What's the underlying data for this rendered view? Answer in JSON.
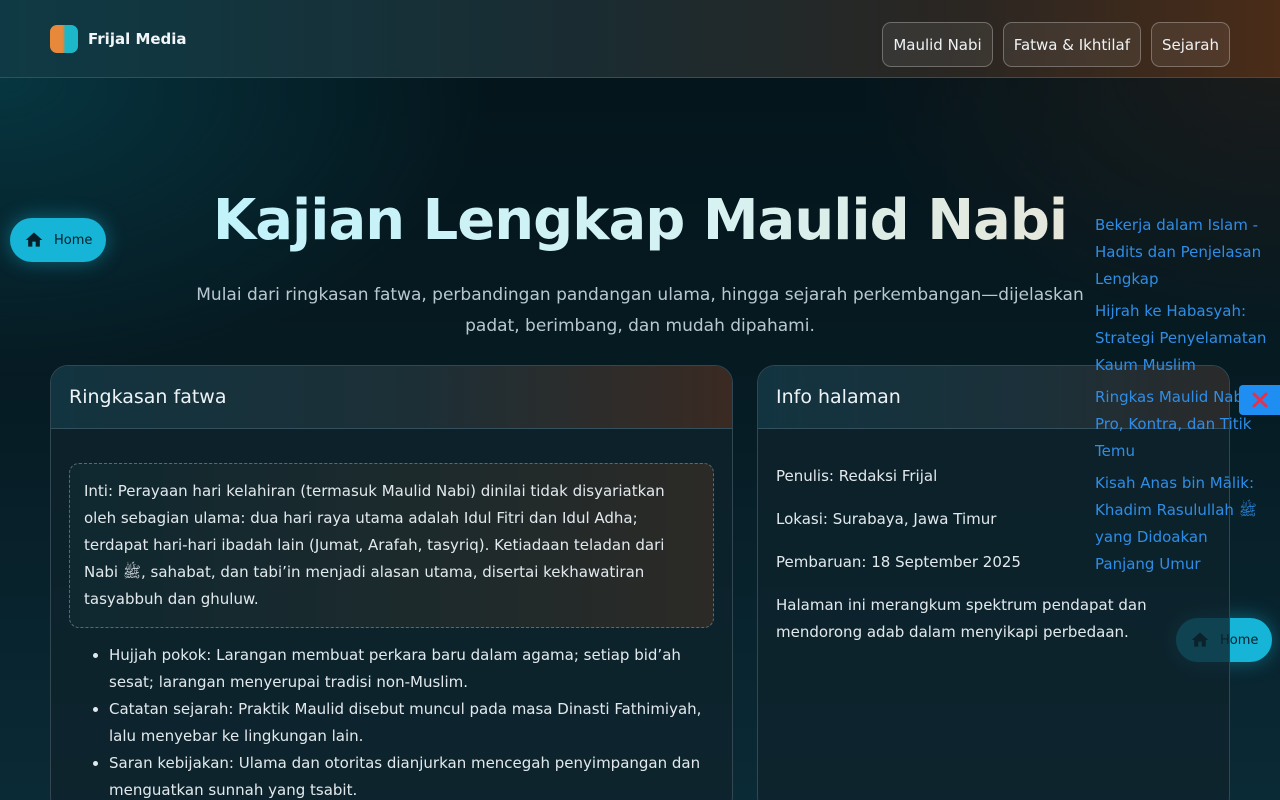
{
  "header": {
    "brand": "Frijal Media",
    "nav": [
      "Maulid Nabi",
      "Fatwa & Ikhtilaf",
      "Sejarah"
    ]
  },
  "hero": {
    "title": "Kajian Lengkap Maulid Nabi",
    "subtitle": "Mulai dari ringkasan fatwa, perbandingan pandangan ulama, hingga sejarah perkembangan—dijelaskan padat, berimbang, dan mudah dipahami."
  },
  "home_button": {
    "label": "Home",
    "icon": "home-icon"
  },
  "fatwa_card": {
    "title": "Ringkasan fatwa",
    "intro": "Inti: Perayaan hari kelahiran (termasuk Maulid Nabi) dinilai tidak disyariatkan oleh sebagian ulama: dua hari raya utama adalah Idul Fitri dan Idul Adha; terdapat hari-hari ibadah lain (Jumat, Arafah, tasyriq). Ketiadaan teladan dari Nabi ﷺ, sahabat, dan tabi’in menjadi alasan utama, disertai kekhawatiran tasyabbuh dan ghuluw.",
    "points": [
      "Hujjah pokok: Larangan membuat perkara baru dalam agama; setiap bid’ah sesat; larangan menyerupai tradisi non-Muslim.",
      "Catatan sejarah: Praktik Maulid disebut muncul pada masa Dinasti Fathimiyah, lalu menyebar ke lingkungan lain.",
      "Saran kebijakan: Ulama dan otoritas dianjurkan mencegah penyimpangan dan menguatkan sunnah yang tsabit."
    ]
  },
  "info_card": {
    "title": "Info halaman",
    "author": "Penulis: Redaksi Frijal",
    "location": "Lokasi: Surabaya, Jawa Timur",
    "updated": "Pembaruan: 18 September 2025",
    "description": "Halaman ini merangkum spektrum pendapat dan mendorong adab dalam menyikapi perbedaan."
  },
  "related": [
    "Bekerja dalam Islam - Hadits dan Penjelasan Lengkap",
    "Hijrah ke Habasyah: Strategi Penyelamatan Kaum Muslim",
    "Ringkas Maulid Nabi: Pro, Kontra, dan Titik Temu",
    "Kisah Anas bin Mālik: Khadim Rasulullah ﷺ yang Didoakan Panjang Umur"
  ],
  "close_icon": "close-icon",
  "colors": {
    "accent": "#16b4d6",
    "link": "#2f8de6",
    "close": "#1e8ef2"
  }
}
